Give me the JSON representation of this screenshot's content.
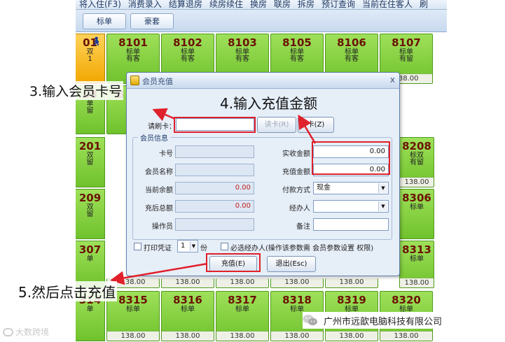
{
  "menu": {
    "items": [
      "将入住(F3)",
      "消费录入",
      "结算退房",
      "续房续住",
      "换房",
      "联房",
      "拆房",
      "预订查询",
      "当前在住客人",
      "刷"
    ]
  },
  "tabs": [
    "标单",
    "豪套"
  ],
  "rooms": [
    {
      "no": "01",
      "type": "双",
      "status": "1",
      "price": "",
      "variant": "occupied-left"
    },
    {
      "no": "8101",
      "type": "标单",
      "status": "有客",
      "price": ""
    },
    {
      "no": "8102",
      "type": "标单",
      "status": "有客",
      "price": ""
    },
    {
      "no": "8103",
      "type": "标单",
      "status": "有客",
      "price": ""
    },
    {
      "no": "8105",
      "type": "标单",
      "status": "有客",
      "price": ""
    },
    {
      "no": "8106",
      "type": "标单",
      "status": "有客",
      "price": ""
    },
    {
      "no": "8107",
      "type": "标单",
      "status": "有留",
      "price": "138.00"
    },
    {
      "no": "08",
      "type": "单",
      "status": "留",
      "price": "",
      "variant": "left"
    },
    {
      "no": "8",
      "type": "",
      "status": "",
      "price": "",
      "variant": "partial"
    },
    {
      "no": "201",
      "type": "双",
      "status": "留",
      "price": "",
      "variant": "left"
    },
    {
      "no": "8208",
      "type": "标双",
      "status": "有留",
      "price": "138.00",
      "variant": "right"
    },
    {
      "no": "209",
      "type": "双",
      "status": "留",
      "price": "",
      "variant": "left"
    },
    {
      "no": "8306",
      "type": "标单",
      "status": "",
      "price": "",
      "variant": "right"
    },
    {
      "no": "307",
      "type": "单",
      "status": "",
      "price": "",
      "variant": "left"
    },
    {
      "no": "8313",
      "type": "标单",
      "status": "",
      "price": "138.00",
      "variant": "right"
    },
    {
      "no": "314",
      "type": "单",
      "status": "",
      "price": "",
      "variant": "left"
    },
    {
      "no": "8315",
      "type": "标单",
      "status": "",
      "price": "138.00"
    },
    {
      "no": "8316",
      "type": "标单",
      "status": "",
      "price": "138.00"
    },
    {
      "no": "8317",
      "type": "标单",
      "status": "",
      "price": "138.00"
    },
    {
      "no": "8318",
      "type": "标单",
      "status": "",
      "price": "138.00"
    },
    {
      "no": "8319",
      "type": "标单",
      "status": "",
      "price": "138.00"
    },
    {
      "no": "8320",
      "type": "标单",
      "status": "",
      "price": "138.00"
    }
  ],
  "row3_prices": [
    "138.00",
    "138.00",
    "138.00",
    "138.00",
    "138.00",
    "138.00"
  ],
  "dialog": {
    "title": "会员充值",
    "close": "x",
    "swipe_label": "请刷卡：",
    "swipe_value": "",
    "read_card_button": "读卡(R)",
    "card_button": "卡(Z)",
    "group_title": "会员信息",
    "card_no_label": "卡号",
    "card_no_value": "",
    "member_name_label": "会员名称",
    "member_name_value": "",
    "balance_label": "当前余额",
    "balance_value": "0.00",
    "after_total_label": "充后总额",
    "after_total_value": "0.00",
    "operator_label": "操作员",
    "operator_value": "",
    "received_label": "实收金额",
    "received_value": "0.00",
    "recharge_label": "充值金额",
    "recharge_value": "0.00",
    "payment_label": "付款方式",
    "payment_value": "现金",
    "handler_label": "经办人",
    "handler_value": "",
    "remark_label": "备注",
    "remark_value": "",
    "print_label": "打印凭证",
    "copies_value": "1",
    "copies_unit": "份",
    "must_handler_label": "必选经办人(操作该参数需 会员参数设置 权限)",
    "recharge_button": "充值(E)",
    "exit_button": "退出(Esc)"
  },
  "annotations": {
    "step3": "3.输入会员卡号",
    "step4": "4.输入充值金额",
    "step5": "5.然后点击充值"
  },
  "watermark": {
    "left": "大数跨境",
    "company": "广州市远歆电脑科技有限公司"
  },
  "colors": {
    "room_green": "#7ccf3a",
    "room_number": "#6b1204",
    "highlight_red": "#e0202a",
    "dialog_bg": "#e6eef8"
  }
}
